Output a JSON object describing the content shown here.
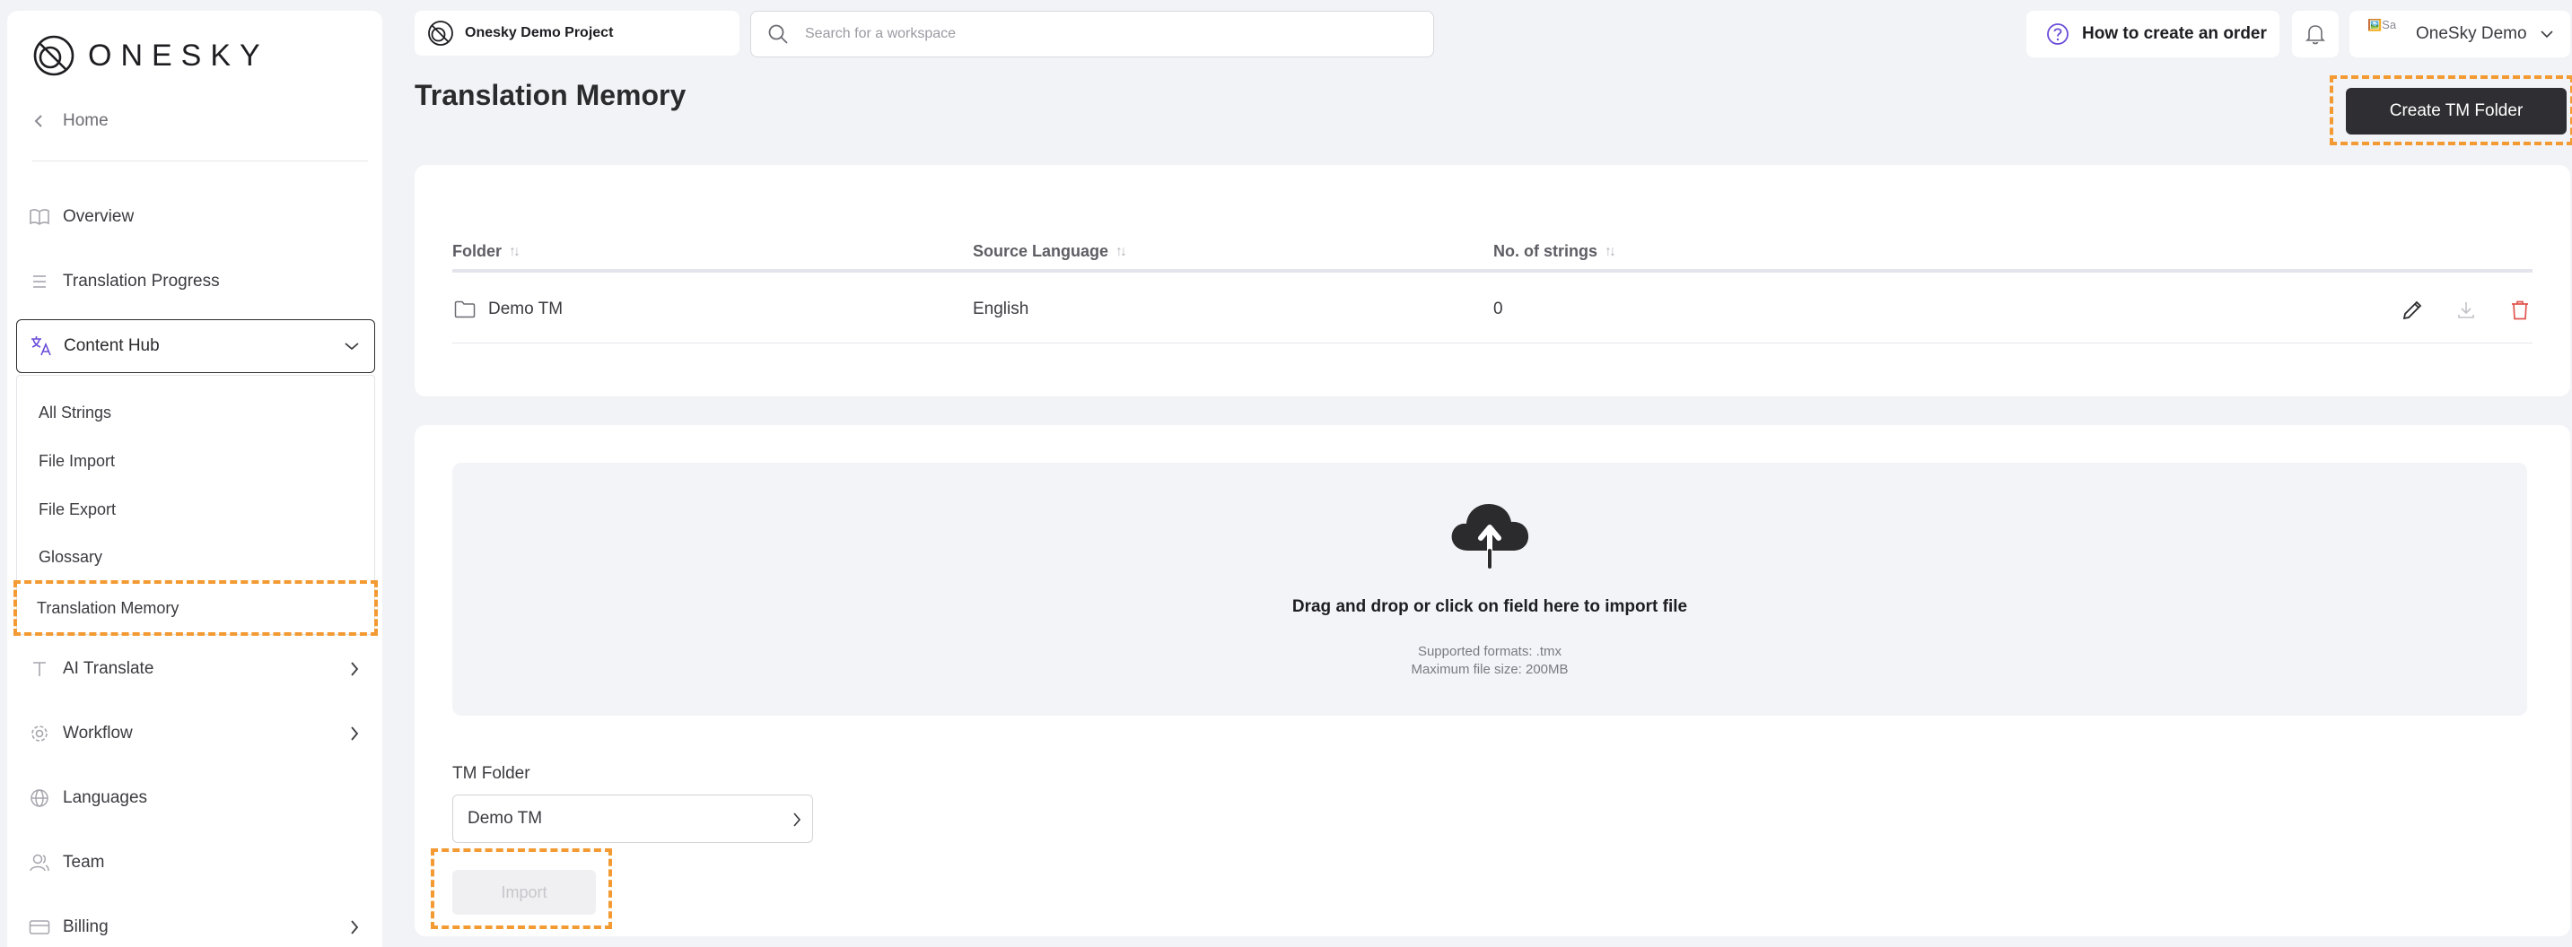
{
  "brand": {
    "logo_text": "ONESKY"
  },
  "sidebar": {
    "back_label": "Home",
    "items": [
      {
        "label": "Overview",
        "icon": "book-icon"
      },
      {
        "label": "Translation Progress",
        "icon": "list-icon"
      },
      {
        "label": "Content Hub",
        "icon": "translate-icon",
        "expanded": true
      },
      {
        "label": "AI Translate",
        "icon": "text-icon"
      },
      {
        "label": "Workflow",
        "icon": "gear-icon"
      },
      {
        "label": "Languages",
        "icon": "globe-icon"
      },
      {
        "label": "Team",
        "icon": "user-icon"
      },
      {
        "label": "Billing",
        "icon": "card-icon"
      }
    ],
    "content_hub_items": [
      {
        "label": "All Strings"
      },
      {
        "label": "File Import"
      },
      {
        "label": "File Export"
      },
      {
        "label": "Glossary"
      },
      {
        "label": "Translation Memory",
        "active": true
      }
    ]
  },
  "topbar": {
    "project_name": "Onesky Demo Project",
    "search_placeholder": "Search for a workspace",
    "help_label": "How to create an order",
    "avatar_alt": "🖼️Sa",
    "user_name": "OneSky Demo"
  },
  "page": {
    "title": "Translation Memory",
    "create_button": "Create TM Folder"
  },
  "table": {
    "columns": [
      "Folder",
      "Source Language",
      "No. of strings"
    ],
    "rows": [
      {
        "folder": "Demo TM",
        "source_language": "English",
        "strings": "0"
      }
    ]
  },
  "import": {
    "drop_title": "Drag and drop or click on field here to import file",
    "formats": "Supported formats: .tmx",
    "max_size": "Maximum file size: 200MB",
    "folder_label": "TM Folder",
    "folder_value": "Demo TM",
    "import_button": "Import"
  },
  "colors": {
    "highlight": "#f39a32",
    "primary_button": "#2f2f33",
    "delete_red": "#e0554f",
    "help_purple": "#6a4bd8"
  }
}
